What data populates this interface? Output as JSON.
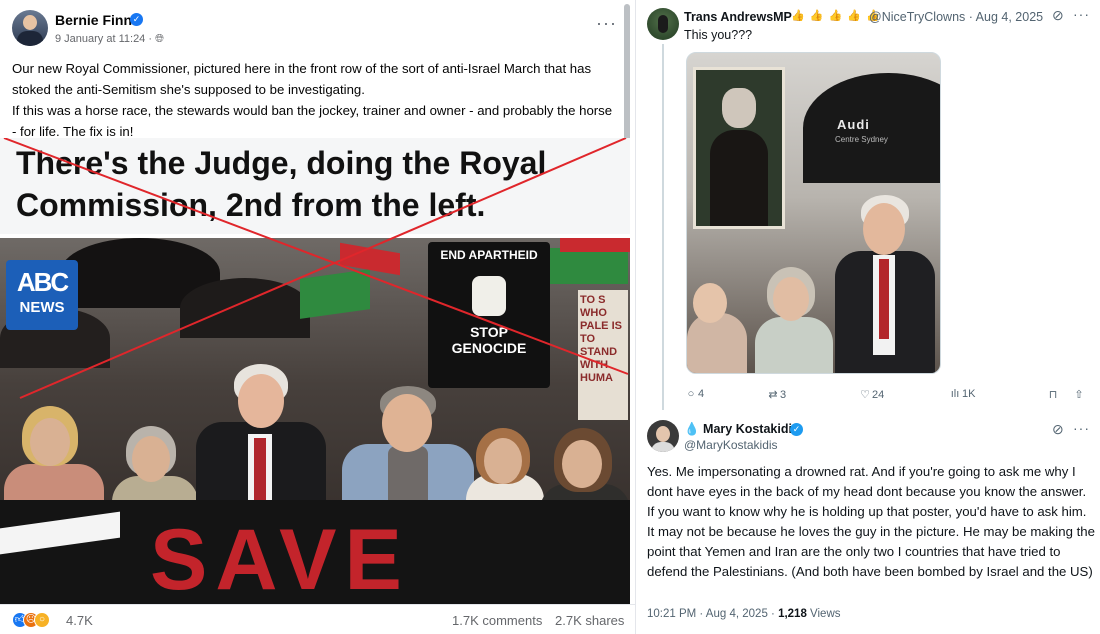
{
  "facebook": {
    "author": "Bernie Finn",
    "timestamp": "9 January at 11:24",
    "separator": "·",
    "audience_icon": "globe-icon",
    "more_label": "···",
    "post_text": [
      "Our new Royal Commissioner, pictured here in the front row of the sort of anti-Israel March that has stoked the anti-Semitism she's supposed to be investigating.",
      "If this was a horse race, the stewards would ban the jockey, trainer and owner - and probably the horse - for life. The fix is in!"
    ],
    "image_caption": "There's the Judge, doing the Royal Commission, 2nd from the left.",
    "image": {
      "watermark_mark": "ABC",
      "watermark_label": "NEWS",
      "sign_top": "END APARTHEID",
      "sign_bottom": "STOP GENOCIDE",
      "poster_text": "TO S WHO PALE IS TO STAND WITH HUMA",
      "banner_text": "SAVE"
    },
    "reaction_count": "4.7K",
    "comments": "1.7K comments",
    "shares": "2.7K shares",
    "colors": {
      "cross_red": "#e0262b",
      "link_blue": "#1877f2"
    }
  },
  "twitter": {
    "tweet1": {
      "name": "Trans AndrewsMP",
      "emojis": "👍 👍 👍 👍 👍",
      "handle_time": "@NiceTryClowns · Aug 4, 2025",
      "text": "This you???",
      "image": {
        "umbrella_brand": "Audi",
        "umbrella_sub": "Centre Sydney"
      },
      "actions": {
        "replies": "4",
        "reposts": "3",
        "likes": "24",
        "views": "1K"
      }
    },
    "tweet2": {
      "name": "💧 Mary Kostakidis",
      "handle": "@MaryKostakidis",
      "text": "Yes. Me impersonating a drowned rat. And if you're going to ask me why I dont have eyes in the back of my head dont because you know the answer. If you want to know why he is holding up that poster, you'd have to ask him. It may not be because he loves the guy in the picture. He may be making the point that Yemen and Iran are the only two I countries that have tried to defend the Palestinians. (And both have been bombed by Israel and the US)",
      "time": "10:21 PM · Aug 4, 2025 · ",
      "views_count": "1,218",
      "views_label": " Views"
    },
    "icons": {
      "grok": "grok-icon",
      "more": "more-icon"
    },
    "colors": {
      "verified_blue": "#1d9bf0",
      "secondary_text": "#536471"
    }
  }
}
